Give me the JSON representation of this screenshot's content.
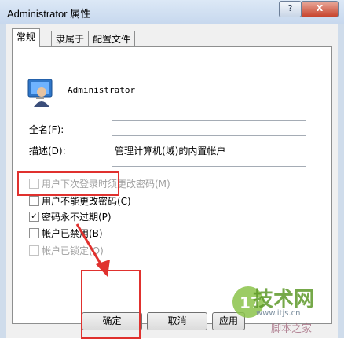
{
  "window": {
    "title": "Administrator 属性",
    "help_label": "?",
    "close_label": "X"
  },
  "tabs": [
    {
      "label": "常规"
    },
    {
      "label": "隶属于"
    },
    {
      "label": "配置文件"
    }
  ],
  "user": {
    "name": "Administrator"
  },
  "fields": {
    "fullname": {
      "label": "全名(F):",
      "value": ""
    },
    "description": {
      "label": "描述(D):",
      "value": "管理计算机(域)的内置帐户"
    }
  },
  "options": [
    {
      "label": "用户下次登录时须更改密码(M)",
      "checked": "",
      "state": "disabled"
    },
    {
      "label": "用户不能更改密码(C)",
      "checked": "",
      "state": "enabled"
    },
    {
      "label": "密码永不过期(P)",
      "checked": "✓",
      "state": "enabled"
    },
    {
      "label": "帐户已禁用(B)",
      "checked": "",
      "state": "enabled"
    },
    {
      "label": "帐户已锁定(O)",
      "checked": "",
      "state": "disabled"
    }
  ],
  "buttons": {
    "ok": "确定",
    "cancel": "取消",
    "apply": "应用"
  },
  "watermark": {
    "brand": "技术网",
    "num": "17",
    "url": "www.itjs.cn",
    "sub": "脚本之家"
  },
  "colors": {
    "highlight": "#e0312e",
    "titlebar": "#c7d8ee"
  }
}
